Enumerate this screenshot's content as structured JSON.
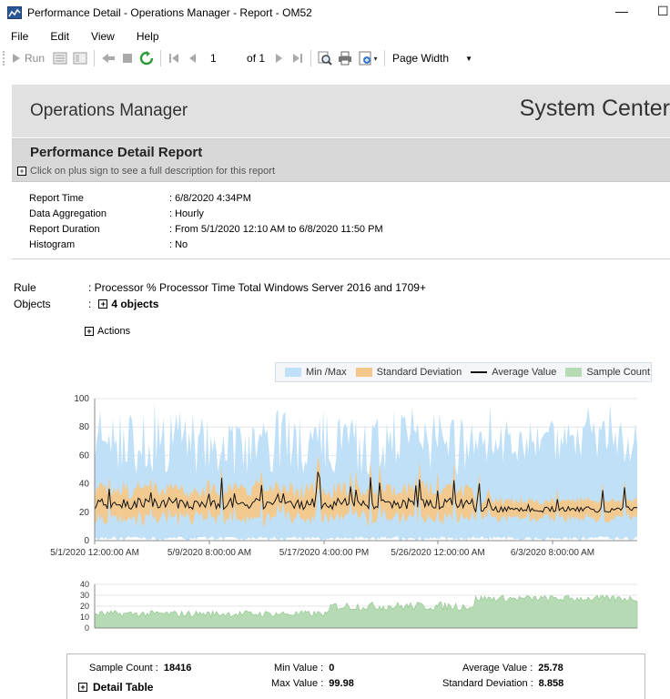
{
  "window": {
    "title": "Performance Detail - Operations Manager - Report - OM52",
    "minimize": "—",
    "maximize": "☐"
  },
  "menu": [
    "File",
    "Edit",
    "View",
    "Help"
  ],
  "toolbar": {
    "run_label": "Run",
    "page_value": "1",
    "of_label": "of 1",
    "zoom_value": "Page Width"
  },
  "header": {
    "product": "Operations Manager",
    "brand": "System Center"
  },
  "report": {
    "title": "Performance Detail Report",
    "hint": "Click on plus sign to see a full description for this report",
    "params": [
      {
        "label": "Report Time",
        "value": ": 6/8/2020 4:34PM"
      },
      {
        "label": "Data Aggregation",
        "value": ": Hourly"
      },
      {
        "label": "Report Duration",
        "value": ": From  5/1/2020 12:10 AM  to  6/8/2020 11:50 PM"
      },
      {
        "label": "Histogram",
        "value": ": No"
      }
    ],
    "rule_label": "Rule",
    "rule_value": ": Processor % Processor Time Total Windows Server 2016 and 1709+",
    "objects_label": "Objects",
    "objects_colon": ":",
    "objects_value": "4 objects",
    "actions_label": "Actions"
  },
  "chart_data": [
    {
      "type": "line",
      "series": [
        {
          "name": "Min /Max",
          "color": "#bfe0f7",
          "kind": "area"
        },
        {
          "name": "Standard Deviation",
          "color": "#f4c88a",
          "kind": "area"
        },
        {
          "name": "Average Value",
          "color": "#111111",
          "kind": "line"
        },
        {
          "name": "Sample Count",
          "color": "#b6dbb4",
          "kind": "area"
        }
      ],
      "y_ticks": [
        "0",
        "20",
        "40",
        "60",
        "80",
        "100"
      ],
      "ylim": [
        0,
        100
      ],
      "x_ticks": [
        "5/1/2020 12:00:00 AM",
        "5/9/2020 8:00:00 AM",
        "5/17/2020 4:00:00 PM",
        "5/26/2020 12:00:00 AM",
        "6/3/2020 8:00:00 AM"
      ],
      "legend_position": "top-right"
    },
    {
      "type": "area",
      "series": [
        {
          "name": "Sample Count"
        }
      ],
      "y_ticks": [
        "0",
        "10",
        "20",
        "30",
        "40"
      ],
      "ylim": [
        0,
        40
      ]
    }
  ],
  "summary": {
    "sample_count_label": "Sample Count :",
    "sample_count": "18416",
    "min_label": "Min Value :",
    "min": "0",
    "max_label": "Max Value :",
    "max": "99.98",
    "avg_label": "Average Value :",
    "avg": "25.78",
    "std_label": "Standard Deviation :",
    "std": "8.858",
    "detail_table_label": "Detail Table"
  }
}
